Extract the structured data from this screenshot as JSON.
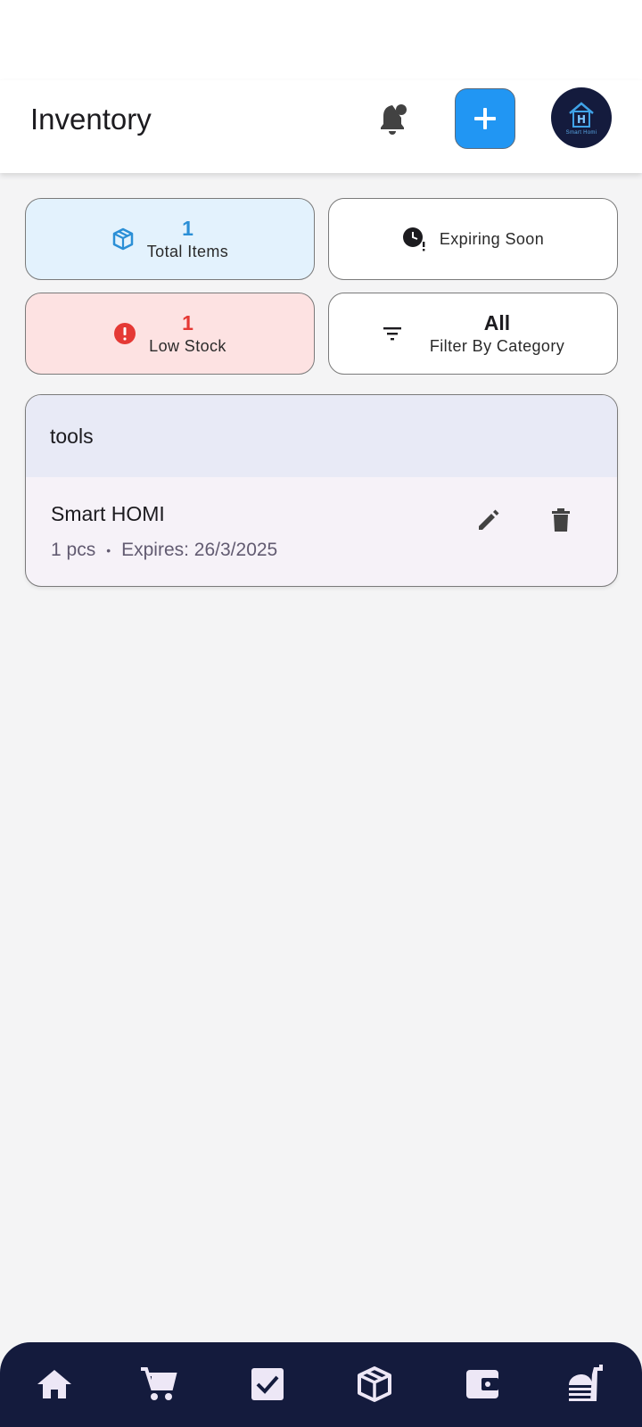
{
  "header": {
    "title": "Inventory",
    "icons": {
      "notifications": "notification-bell-icon",
      "add": "plus-icon",
      "avatar": "smart-homi-logo"
    },
    "avatar_text": "Smart Homi"
  },
  "summary": {
    "total_items": {
      "value": "1",
      "label": "Total Items",
      "icon": "box-icon",
      "color": "#2b8fd6"
    },
    "expiring_soon": {
      "label": "Expiring Soon",
      "icon": "clock-alert-icon"
    },
    "low_stock": {
      "value": "1",
      "label": "Low Stock",
      "icon": "alert-circle-icon",
      "color": "#e53935"
    },
    "filter": {
      "value": "All",
      "label": "Filter By Category",
      "icon": "filter-icon"
    }
  },
  "groups": [
    {
      "name": "tools",
      "items": [
        {
          "name": "Smart HOMI",
          "quantity": "1 pcs",
          "separator": "•",
          "expires": "Expires: 26/3/2025"
        }
      ]
    }
  ],
  "bottom_nav": {
    "items": [
      {
        "icon": "home-icon"
      },
      {
        "icon": "cart-icon"
      },
      {
        "icon": "checkbox-icon"
      },
      {
        "icon": "inventory-box-icon"
      },
      {
        "icon": "wallet-icon"
      },
      {
        "icon": "food-icon"
      }
    ]
  },
  "colors": {
    "accent": "#2196f3",
    "nav_background": "#141b3d",
    "total_card_bg": "#e3f2fd",
    "low_stock_card_bg": "#fde2e2",
    "group_header_bg": "#e8eaf6"
  }
}
